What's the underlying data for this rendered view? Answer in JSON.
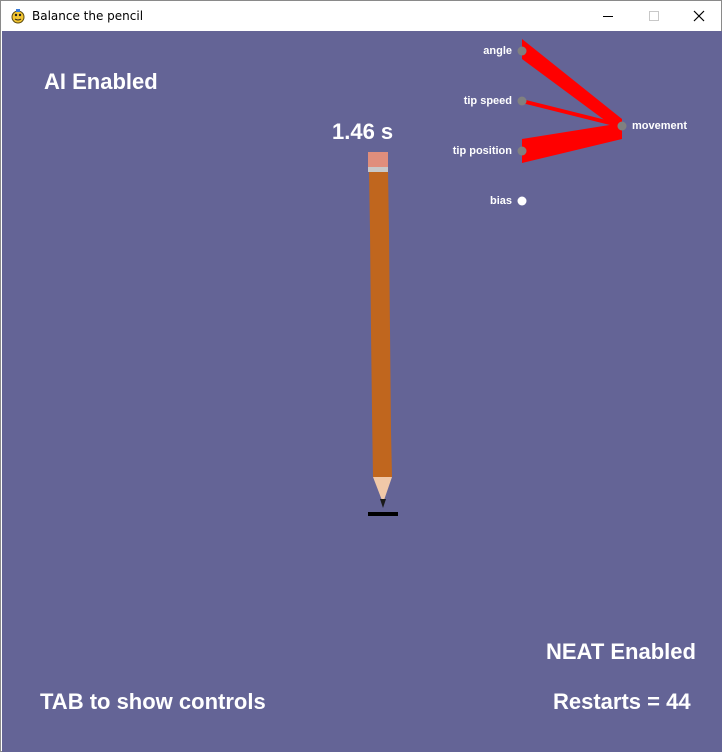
{
  "window": {
    "title": "Balance the pencil"
  },
  "hud": {
    "ai_status": "AI Enabled",
    "timer": "1.46 s",
    "neat_status": "NEAT Enabled",
    "controls_hint": "TAB to show controls",
    "restarts": "Restarts = 44"
  },
  "network": {
    "inputs": [
      "angle",
      "tip speed",
      "tip position",
      "bias"
    ],
    "output": "movement"
  },
  "colors": {
    "background": "#646496",
    "pencil_body": "#c0661e",
    "connection": "#ff0000",
    "node": "#808080"
  }
}
